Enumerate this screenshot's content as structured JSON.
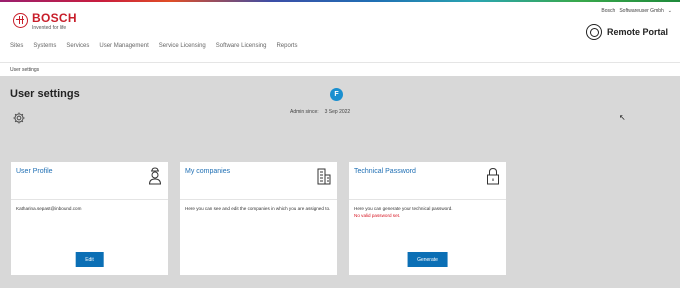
{
  "header": {
    "brand": "BOSCH",
    "tagline": "Invented for life",
    "user_name": "Bosch",
    "user_company": "Softwareuser Gmbh",
    "portal_title": "Remote Portal"
  },
  "nav": [
    "Sites",
    "Systems",
    "Services",
    "User Management",
    "Service Licensing",
    "Software Licensing",
    "Reports"
  ],
  "breadcrumb": "User settings",
  "page": {
    "title": "User settings",
    "badge": "F",
    "admin_label": "Admin since:",
    "admin_date": "3 Sep 2022"
  },
  "cards": {
    "profile": {
      "title": "User Profile",
      "text": "Katharina.sepast@inbound.com",
      "button": "Edit"
    },
    "companies": {
      "title": "My companies",
      "text": "Here you can see and edit the companies in which you are assigned to."
    },
    "password": {
      "title": "Technical Password",
      "text": "Here you can generate your technical password.",
      "warning": "No valid password set.",
      "button": "Generate"
    }
  },
  "colors": {
    "brand_red": "#c81e2a",
    "link_blue": "#1f6fb4",
    "button_blue": "#0b6fb5",
    "warning_red": "#d6111e",
    "background": "#d8d8d8"
  }
}
